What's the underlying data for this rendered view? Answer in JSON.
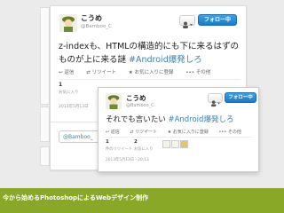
{
  "tweet_back": {
    "name": "こうめ",
    "handle": "@Bamboo_C",
    "follow_label": "フォロー中",
    "text_main": "z-indexも、HTMLの構造的にも下に来るはずのものが上に来る謎 ",
    "hashtag": "#Android爆発しろ",
    "actions": {
      "reply": "返信",
      "retweet": "リツイート",
      "favorite": "お気に入りに登録",
      "more": "その他"
    },
    "stat_num": "1",
    "stat_label": "お気に入り",
    "date": "2013年5月13日",
    "reply_prefill": "@Bamboo_"
  },
  "tweet_front": {
    "name": "こうめ",
    "handle": "@Bamboo_C",
    "follow_label": "フォロー中",
    "text_main": "それでも言いたい ",
    "hashtag": "#Android爆発しろ",
    "actions": {
      "reply": "返信",
      "retweet": "リツイート",
      "favorite": "お気に入りに登録",
      "more": "その他"
    },
    "stat1_num": "1",
    "stat1_label": "件のリツイート",
    "stat2_num": "2",
    "stat2_label": "お気に入り",
    "date": "2013年5月13日 - 20:13"
  },
  "banner": {
    "text": "今から始めるPhotoshopによるWebデザイン制作"
  },
  "colors": {
    "banner": "#8aa828",
    "follow": "#1d7ac4",
    "hashtag": "#3b83b0"
  }
}
